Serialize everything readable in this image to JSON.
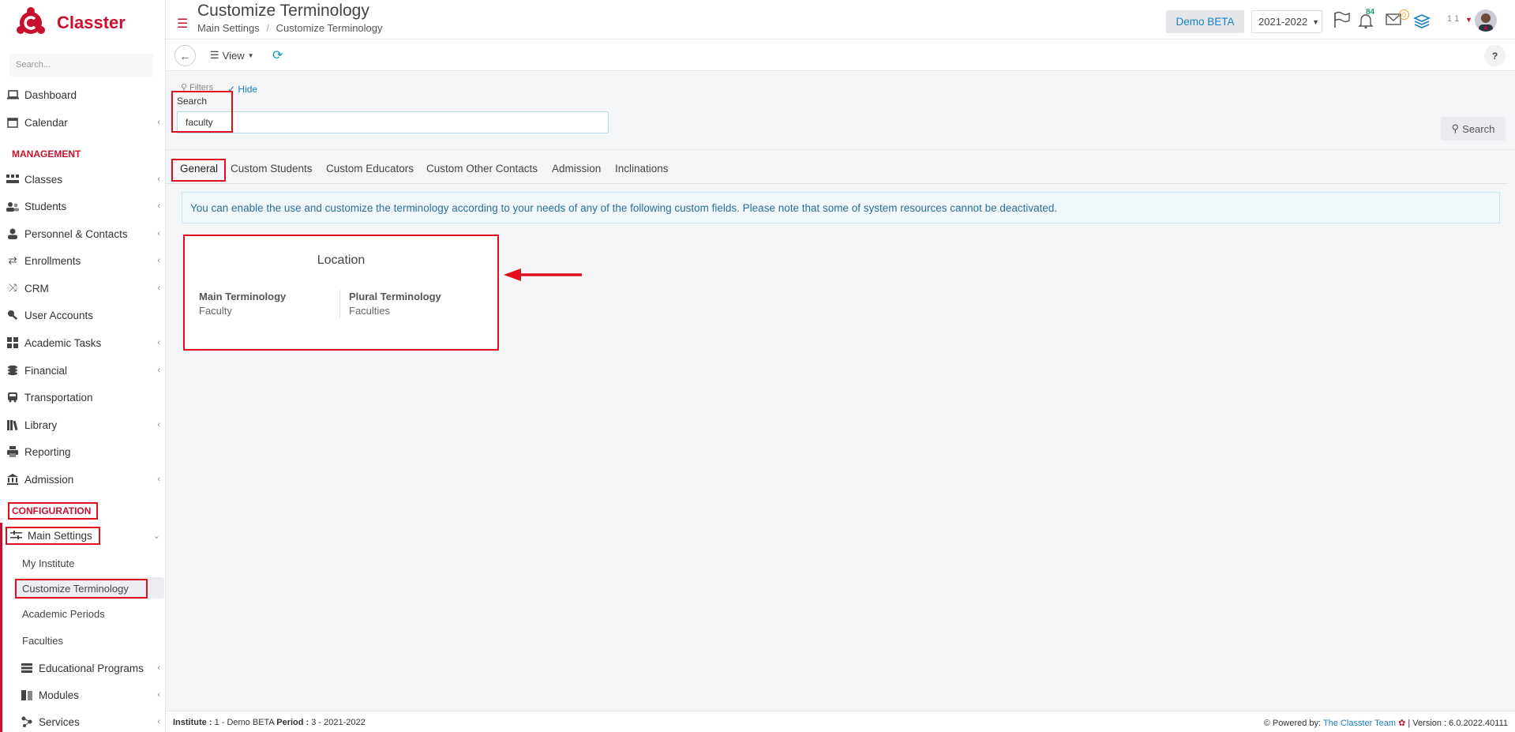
{
  "app": {
    "name": "Classter"
  },
  "sidebar": {
    "search_placeholder": "Search...",
    "items": [
      {
        "label": "Dashboard"
      },
      {
        "label": "Calendar"
      },
      {
        "label": "Classes"
      },
      {
        "label": "Students"
      },
      {
        "label": "Personnel & Contacts"
      },
      {
        "label": "Enrollments"
      },
      {
        "label": "CRM"
      },
      {
        "label": "User Accounts"
      },
      {
        "label": "Academic Tasks"
      },
      {
        "label": "Financial"
      },
      {
        "label": "Transportation"
      },
      {
        "label": "Library"
      },
      {
        "label": "Reporting"
      },
      {
        "label": "Admission"
      },
      {
        "label": "Main Settings"
      },
      {
        "label": "Educational Programs"
      },
      {
        "label": "Modules"
      },
      {
        "label": "Services"
      }
    ],
    "management_label": "MANAGEMENT",
    "configuration_label": "CONFIGURATION",
    "sub_items": [
      {
        "label": "My Institute"
      },
      {
        "label": "Customize Terminology"
      },
      {
        "label": "Academic Periods"
      },
      {
        "label": "Faculties"
      }
    ]
  },
  "header": {
    "title": "Customize Terminology",
    "breadcrumb_1": "Main Settings",
    "breadcrumb_sep": "/",
    "breadcrumb_2": "Customize Terminology",
    "institute": "Demo BETA",
    "period": "2021-2022",
    "notifications_count": "84",
    "messages_count": "0",
    "user_code": "1 1"
  },
  "toolbar": {
    "view_label": "View",
    "help_label": "?"
  },
  "filters": {
    "filters_label": "Filters",
    "hide_label": "Hide",
    "search_label": "Search",
    "search_value": "faculty",
    "search_button": "Search"
  },
  "tabs": [
    {
      "label": "General"
    },
    {
      "label": "Custom Students"
    },
    {
      "label": "Custom Educators"
    },
    {
      "label": "Custom Other Contacts"
    },
    {
      "label": "Admission"
    },
    {
      "label": "Inclinations"
    }
  ],
  "info_text": "You can enable the use and customize the terminology according to your needs of any of the following custom fields. Please note that some of system resources cannot be deactivated.",
  "card": {
    "title": "Location",
    "main_label": "Main Terminology",
    "main_value": "Faculty",
    "plural_label": "Plural Terminology",
    "plural_value": "Faculties"
  },
  "footer": {
    "institute_label": "Institute :",
    "institute_value": "1 - Demo BETA",
    "period_label": "Period :",
    "period_value": "3 - 2021-2022",
    "powered_by": "Powered by:",
    "team": "The Classter Team",
    "version": "| Version : 6.0.2022.40111"
  },
  "colors": {
    "brand": "#c8102e",
    "highlight": "#e10e1e",
    "link": "#1a7fc1"
  }
}
